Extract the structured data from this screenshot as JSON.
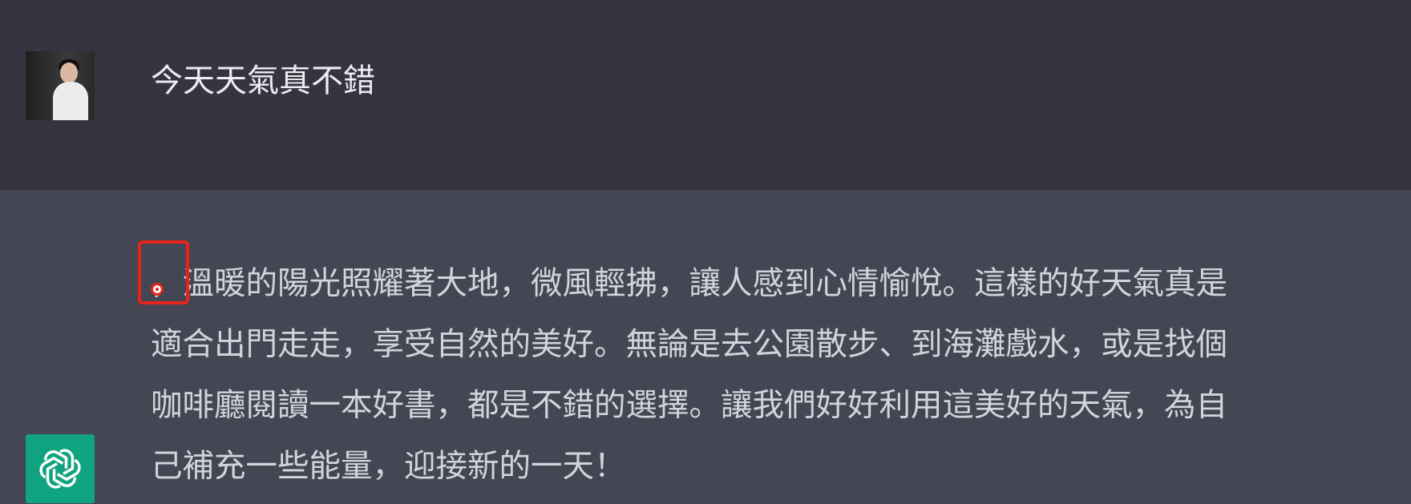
{
  "user_message": {
    "text": "今天天氣真不錯"
  },
  "assistant_message": {
    "lines": [
      "，溫暖的陽光照耀著大地，微風輕拂，讓人感到心情愉悅。這樣的好天氣真是",
      "適合出門走走，享受自然的美好。無論是去公園散步、到海灘戲水，或是找個",
      "咖啡廳閱讀一本好書，都是不錯的選擇。讓我們好好利用這美好的天氣，為自",
      "己補充一些能量，迎接新的一天！"
    ]
  },
  "icons": {
    "user_avatar": "user-avatar-photo",
    "assistant_avatar": "openai-logo-icon"
  },
  "colors": {
    "user_bg": "#343541",
    "assistant_bg": "#444654",
    "bot_avatar": "#10a37f",
    "highlight": "#e8241a"
  }
}
